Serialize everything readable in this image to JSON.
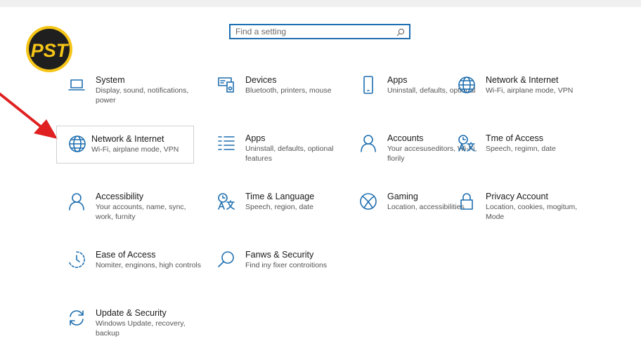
{
  "search": {
    "placeholder": "Find a setting"
  },
  "logo": {
    "text": "PST"
  },
  "tiles": [
    {
      "title": "System",
      "desc": "Display, sound, notifications, power",
      "icon": "laptop-icon"
    },
    {
      "title": "Devices",
      "desc": "Bluetooth, printers, mouse",
      "icon": "devices-icon"
    },
    {
      "title": "Apps",
      "desc": "Uninstall, defaults, optional",
      "icon": "phone-icon"
    },
    {
      "title": "Network & Internet",
      "desc": "Wi-Fi, airplane mode, VPN",
      "icon": "globe-icon"
    },
    {
      "title": "Network & Internet",
      "desc": "Wi-Fi, airplane mode, VPN",
      "icon": "globe-icon",
      "selected": true
    },
    {
      "title": "Apps",
      "desc": "Uninstall, defaults, optional features",
      "icon": "apps-list-icon"
    },
    {
      "title": "Accounts",
      "desc": "Your accesuseditors, Wi-Fi, florily",
      "icon": "person-icon"
    },
    {
      "title": "Tme of Access",
      "desc": "Speech, regimn, date",
      "icon": "time-language-icon"
    },
    {
      "title": "Accessibility",
      "desc": "Your accounts, name, sync, work, furnity",
      "icon": "person-icon"
    },
    {
      "title": "Time & Language",
      "desc": "Speech, region, date",
      "icon": "time-language-icon"
    },
    {
      "title": "Gaming",
      "desc": "Location, accessibilities",
      "icon": "xbox-icon"
    },
    {
      "title": "Privacy Account",
      "desc": "Location, cookies, mogitum, Mode",
      "icon": "lock-icon"
    },
    {
      "title": "Ease of Access",
      "desc": "Nomiter, enginons, high controls",
      "icon": "ease-of-access-icon"
    },
    {
      "title": "Fanws & Security",
      "desc": "Find iny fixer controitions",
      "icon": "search-icon"
    },
    {
      "title": "Update & Security",
      "desc": "Windows Update, recovery, backup",
      "icon": "sync-icon"
    }
  ],
  "colors": {
    "accent": "#1e6eaf",
    "annotation_arrow": "#e02020",
    "logo_ring": "#f5c518"
  }
}
